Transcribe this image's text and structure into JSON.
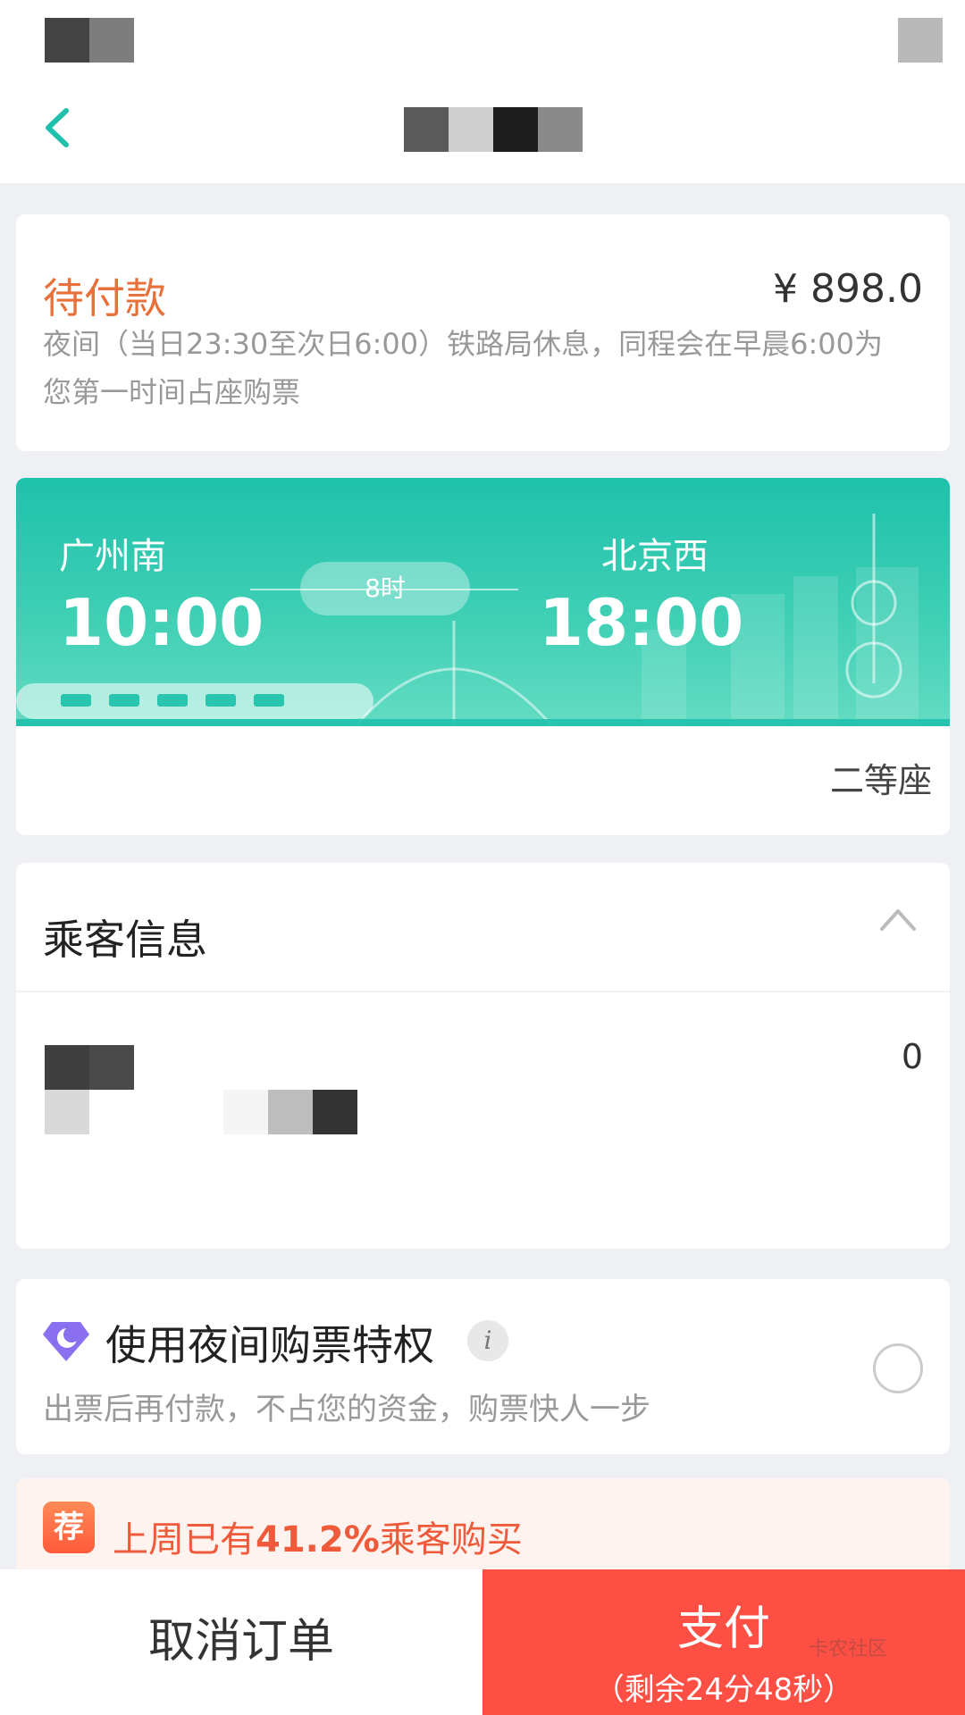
{
  "header": {
    "back_icon": "chevron-left-icon"
  },
  "order": {
    "status": "待付款",
    "price": "¥ 898.0",
    "note": "夜间（当日23:30至次日6:00）铁路局休息，同程会在早晨6:00为您第一时间占座购票"
  },
  "train": {
    "from_station": "广州南",
    "from_time": "10:00",
    "to_station": "北京西",
    "to_time": "18:00",
    "duration": "8时",
    "seat_class": "二等座"
  },
  "passenger": {
    "title": "乘客信息",
    "count": "0",
    "collapse_icon": "chevron-up-icon"
  },
  "privilege": {
    "title": "使用夜间购票特权",
    "info": "i",
    "desc": "出票后再付款，不占您的资金，购票快人一步"
  },
  "recommend": {
    "badge": "荐",
    "prefix": "上周已有",
    "percent": "41.2%",
    "suffix": "乘客购买"
  },
  "bottom": {
    "cancel": "取消订单",
    "pay": "支付",
    "timer": "（剩余24分48秒）",
    "watermark": "卡农社区"
  },
  "colors": {
    "accent": "#1fc1ac",
    "pay": "#fe4f45",
    "pending": "#e8703a"
  }
}
